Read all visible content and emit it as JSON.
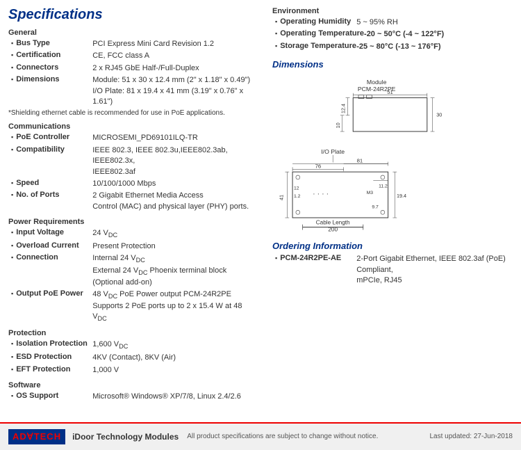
{
  "page": {
    "title": "Specifications"
  },
  "sections": {
    "general": {
      "heading": "General",
      "items": [
        {
          "label": "Bus Type",
          "value": "PCI Express Mini Card Revision 1.2"
        },
        {
          "label": "Certification",
          "value": "CE, FCC class A"
        },
        {
          "label": "Connectors",
          "value": "2 x RJ45 GbE Half-/Full-Duplex"
        },
        {
          "label": "Dimensions",
          "value": "Module: 51 x 30 x 12.4 mm (2\" x 1.18\" x 0.49\")\nI/O Plate: 81 x 19.4 x 41 mm (3.19\" x 0.76\" x 1.61\")"
        }
      ],
      "note": "*Shielding ethernet cable is recommended for use in PoE applications."
    },
    "communications": {
      "heading": "Communications",
      "items": [
        {
          "label": "PoE Controller",
          "value": "MICROSEMI_PD69101ILQ-TR"
        },
        {
          "label": "Compatibility",
          "value": "IEEE 802.3, IEEE 802.3u,IEEE802.3ab, IEEE802.3x, IEEE802.3af"
        },
        {
          "label": "Speed",
          "value": "10/100/1000 Mbps"
        },
        {
          "label": "No. of Ports",
          "value": "2 Gigabit Ethernet Media Access\nControl (MAC) and physical layer (PHY) ports."
        }
      ]
    },
    "power": {
      "heading": "Power Requirements",
      "items": [
        {
          "label": "Input Voltage",
          "value": "24 VᴅC"
        },
        {
          "label": "Overload Current",
          "value": "Present Protection"
        },
        {
          "label": "Connection",
          "value": "Internal 24 VᴅC\nExternal 24 VᴅC Phoenix terminal block (Optional add-on)"
        },
        {
          "label": "Output PoE Power",
          "value": "48 VᴅC PoE Power output PCM-24R2PE\nSupports 2 PoE ports up to 2 x 15.4 W at 48 VᴅC"
        }
      ]
    },
    "protection": {
      "heading": "Protection",
      "items": [
        {
          "label": "Isolation Protection",
          "value": "1,600 VᴅC"
        },
        {
          "label": "ESD Protection",
          "value": "4KV (Contact), 8KV (Air)"
        },
        {
          "label": "EFT Protection",
          "value": "1,000 V"
        }
      ]
    },
    "software": {
      "heading": "Software",
      "items": [
        {
          "label": "OS Support",
          "value": "Microsoft® Windows® XP/7/8, Linux 2.4/2.6"
        }
      ]
    },
    "environment": {
      "heading": "Environment",
      "items": [
        {
          "label": "Operating Humidity",
          "value": "5 ~ 95% RH"
        },
        {
          "label": "Operating Temperature",
          "value": "-20 ~ 50°C (-4 ~ 122°F)"
        },
        {
          "label": "Storage Temperature",
          "value": "-25 ~ 80°C (-13 ~ 176°F)"
        }
      ]
    }
  },
  "dimensions": {
    "heading": "Dimensions"
  },
  "ordering": {
    "heading": "Ordering Information",
    "items": [
      {
        "label": "PCM-24R2PE-AE",
        "value": "2-Port Gigabit Ethernet, IEEE 802.3af (PoE) Compliant,\nmPCIe, RJ45"
      }
    ]
  },
  "footer": {
    "logo_text": "ADΟTECH",
    "logo_ad": "AD",
    "logo_van": "Ο",
    "logo_tech": "TECH",
    "brand_name": "ADVANTECH",
    "module_text": "iDoor Technology Modules",
    "note": "All product specifications are subject to change without notice.",
    "date": "Last updated: 27-Jun-2018"
  }
}
